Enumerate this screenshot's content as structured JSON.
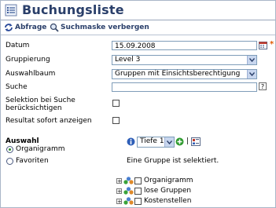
{
  "title": "Buchungsliste",
  "toolbar": {
    "query_label": "Abfrage",
    "hide_search_label": "Suchmaske verbergen"
  },
  "form": {
    "date": {
      "label": "Datum",
      "value": "15.09.2008",
      "required_marker": "*"
    },
    "grouping": {
      "label": "Gruppierung",
      "value": "Level 3"
    },
    "tree": {
      "label": "Auswahlbaum",
      "value": "Gruppen mit Einsichtsberechtigung"
    },
    "search": {
      "label": "Suche",
      "value": "",
      "help": "?"
    },
    "selection_search": {
      "label_line1": "Selektion bei Suche",
      "label_line2": "berücksichtigen",
      "checked": false
    },
    "show_result": {
      "label": "Resultat sofort anzeigen",
      "checked": false
    }
  },
  "selection": {
    "title": "Auswahl",
    "options": [
      {
        "label": "Organigramm",
        "selected": true
      },
      {
        "label": "Favoriten",
        "selected": false
      }
    ],
    "depth_value": "Tiefe 1",
    "separator": "|",
    "status_text": "Eine Gruppe ist selektiert.",
    "tree_items": [
      {
        "label": "Organigramm"
      },
      {
        "label": "lose Gruppen"
      },
      {
        "label": "Kostenstellen"
      }
    ]
  },
  "colors": {
    "title": "#2a3f6a",
    "required": "#e05a00",
    "accent": "#2a8a2a"
  }
}
